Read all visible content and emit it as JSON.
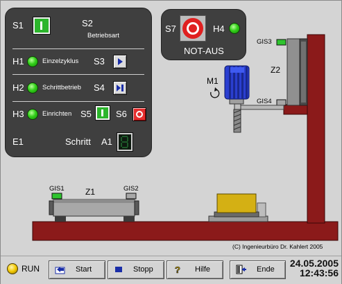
{
  "panel": {
    "s1": "S1",
    "s2": "S2",
    "betriebsart": "Betriebsart",
    "h1": "H1",
    "einzelzyklus": "Einzelzyklus",
    "s3": "S3",
    "h2": "H2",
    "schrittbetrieb": "Schrittbetrieb",
    "s4": "S4",
    "h3": "H3",
    "einrichten": "Einrichten",
    "s5": "S5",
    "s6": "S6",
    "e1": "E1",
    "schritt": "Schritt",
    "a1": "A1"
  },
  "estop_panel": {
    "s7": "S7",
    "h4": "H4",
    "title": "NOT-AUS"
  },
  "machine": {
    "m1": "M1",
    "z1": "Z1",
    "z2": "Z2",
    "gis1": "GIS1",
    "gis2": "GIS2",
    "gis3": "GIS3",
    "gis4": "GIS4",
    "copyright": "(C) Ingenieurbüro Dr. Kahlert 2005"
  },
  "status": {
    "run": "RUN",
    "date": "24.05.2005",
    "time": "12:43:56"
  },
  "toolbar": {
    "start": "Start",
    "stopp": "Stopp",
    "hilfe": "Hilfe",
    "ende": "Ende"
  },
  "colors": {
    "panel_bg": "#3f3f3f",
    "led_green": "#33d01a",
    "frame_red": "#8b1a1a",
    "motor_blue": "#2a3fd0",
    "workpiece_yellow": "#d4b014",
    "estop_red": "#e02020"
  },
  "icons": [
    "push-button-icon",
    "play-icon",
    "step-icon",
    "reset-icon",
    "segment-display-icon",
    "emergency-stop-icon",
    "rotation-icon",
    "start-icon",
    "stop-icon",
    "help-icon",
    "exit-icon"
  ]
}
